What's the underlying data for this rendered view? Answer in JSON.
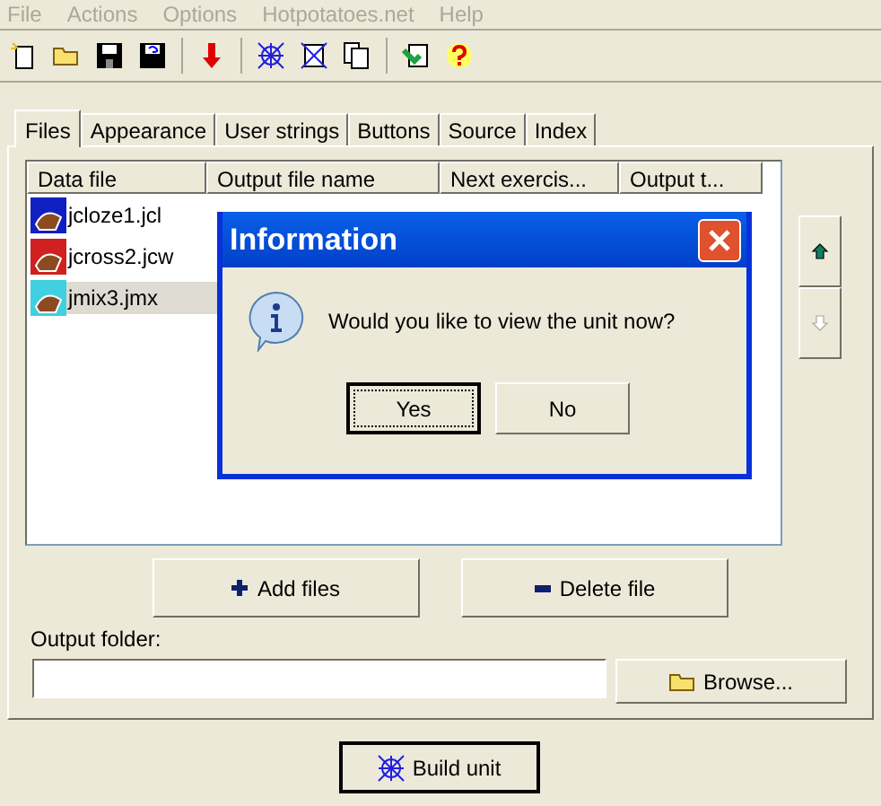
{
  "menu": [
    {
      "label": "File",
      "disabled": true
    },
    {
      "label": "Actions",
      "disabled": true
    },
    {
      "label": "Options",
      "disabled": true
    },
    {
      "label": "Hotpotatoes.net",
      "disabled": true
    },
    {
      "label": "Help",
      "disabled": true
    }
  ],
  "tabs": [
    {
      "label": "Files",
      "selected": true
    },
    {
      "label": "Appearance",
      "selected": false
    },
    {
      "label": "User strings",
      "selected": false
    },
    {
      "label": "Buttons",
      "selected": false
    },
    {
      "label": "Source",
      "selected": false
    },
    {
      "label": "Index",
      "selected": false
    }
  ],
  "table": {
    "columns": [
      "Data file",
      "Output file name",
      "Next exercis...",
      "Output t..."
    ],
    "rows": [
      {
        "file": "jcloze1.jcl",
        "color": "#1020c0",
        "selected": false
      },
      {
        "file": "jcross2.jcw",
        "color": "#d02020",
        "selected": false
      },
      {
        "file": "jmix3.jmx",
        "color": "#40d0e0",
        "selected": true
      }
    ]
  },
  "move_buttons": [
    {
      "kind": "up",
      "disabled": false
    },
    {
      "kind": "down",
      "disabled": true
    }
  ],
  "add_button": "Add files",
  "delete_button": "Delete file",
  "output_folder": {
    "label": "Output folder:",
    "browse": "Browse..."
  },
  "build_button": "Build unit",
  "dialog": {
    "title": "Information",
    "message": "Would you like to view the unit now?",
    "buttons": [
      {
        "label": "Yes",
        "default": true
      },
      {
        "label": "No",
        "default": false
      }
    ]
  }
}
